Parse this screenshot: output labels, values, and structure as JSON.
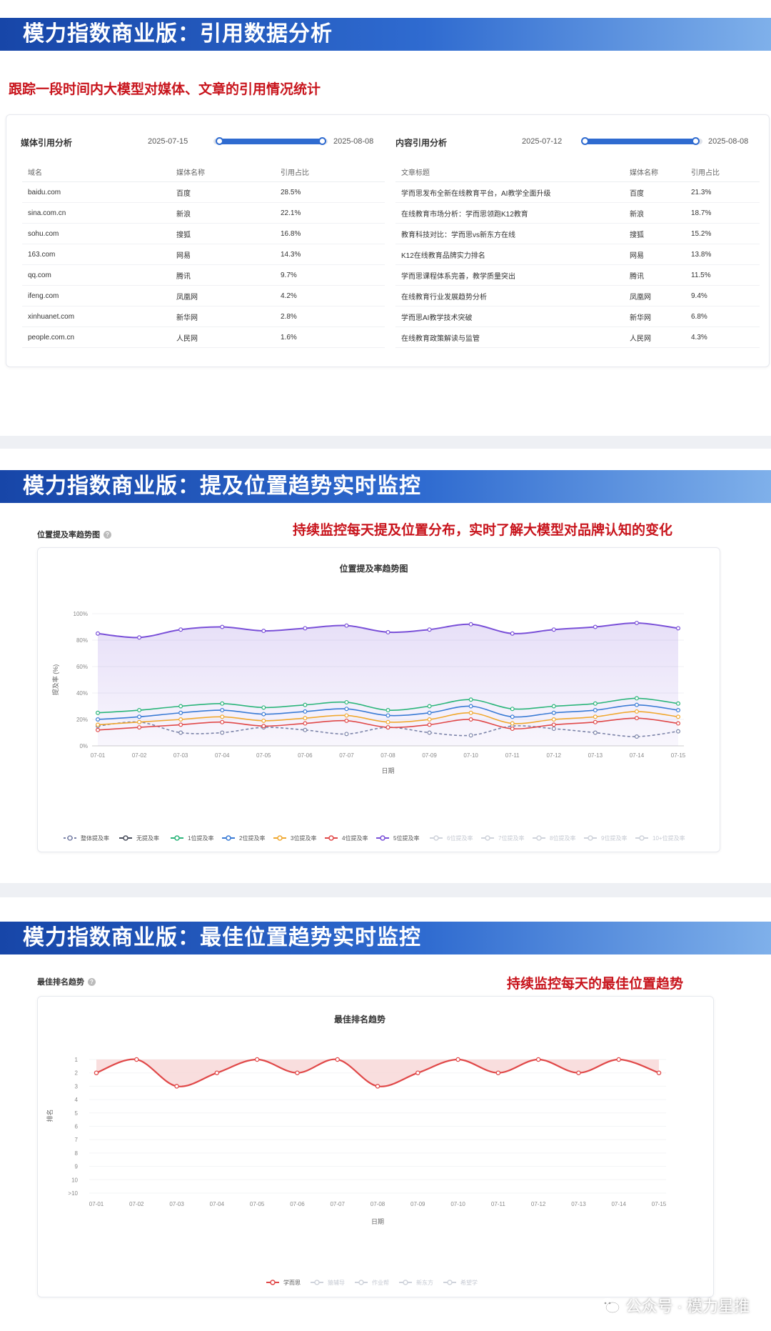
{
  "section1": {
    "banner": "模力指数商业版：引用数据分析",
    "subtitle": "跟踪一段时间内大模型对媒体、文章的引用情况统计",
    "media": {
      "title": "媒体引用分析",
      "date_start": "2025-07-15",
      "date_end": "2025-08-08",
      "headers": [
        "域名",
        "媒体名称",
        "引用占比"
      ],
      "rows": [
        [
          "baidu.com",
          "百度",
          "28.5%"
        ],
        [
          "sina.com.cn",
          "新浪",
          "22.1%"
        ],
        [
          "sohu.com",
          "搜狐",
          "16.8%"
        ],
        [
          "163.com",
          "网易",
          "14.3%"
        ],
        [
          "qq.com",
          "腾讯",
          "9.7%"
        ],
        [
          "ifeng.com",
          "凤凰网",
          "4.2%"
        ],
        [
          "xinhuanet.com",
          "新华网",
          "2.8%"
        ],
        [
          "people.com.cn",
          "人民网",
          "1.6%"
        ]
      ]
    },
    "content": {
      "title": "内容引用分析",
      "date_start": "2025-07-12",
      "date_end": "2025-08-08",
      "headers": [
        "文章标题",
        "媒体名称",
        "引用占比"
      ],
      "rows": [
        [
          "学而思发布全新在线教育平台，AI教学全面升级",
          "百度",
          "21.3%"
        ],
        [
          "在线教育市场分析：学而思领跑K12教育",
          "新浪",
          "18.7%"
        ],
        [
          "教育科技对比：学而思vs新东方在线",
          "搜狐",
          "15.2%"
        ],
        [
          "K12在线教育品牌实力排名",
          "网易",
          "13.8%"
        ],
        [
          "学而思课程体系完善，教学质量突出",
          "腾讯",
          "11.5%"
        ],
        [
          "在线教育行业发展趋势分析",
          "凤凰网",
          "9.4%"
        ],
        [
          "学而思AI教学技术突破",
          "新华网",
          "6.8%"
        ],
        [
          "在线教育政策解读与监管",
          "人民网",
          "4.3%"
        ]
      ]
    }
  },
  "section2": {
    "banner": "模力指数商业版：提及位置趋势实时监控",
    "panel_label": "位置提及率趋势图",
    "subtitle": "持续监控每天提及位置分布，实时了解大模型对品牌认知的变化",
    "chart_data": {
      "type": "area",
      "title": "位置提及率趋势图",
      "xlabel": "日期",
      "ylabel": "提及率 (%)",
      "ylim": [
        0,
        100
      ],
      "y_ticks": [
        "0%",
        "20%",
        "40%",
        "60%",
        "80%",
        "100%"
      ],
      "x": [
        "07-01",
        "07-02",
        "07-03",
        "07-04",
        "07-05",
        "07-06",
        "07-07",
        "07-08",
        "07-09",
        "07-10",
        "07-11",
        "07-12",
        "07-13",
        "07-14",
        "07-15"
      ],
      "series": [
        {
          "name": "整体提及率",
          "color": "#7b83a8",
          "dashed": true,
          "values": [
            15,
            18,
            10,
            10,
            14,
            12,
            9,
            14,
            10,
            8,
            15,
            13,
            10,
            7,
            11
          ]
        },
        {
          "name": "无提及率",
          "color": "#4a4f5c",
          "values": [
            null,
            null,
            null,
            null,
            null,
            null,
            null,
            null,
            null,
            null,
            null,
            null,
            null,
            null,
            null
          ]
        },
        {
          "name": "1位提及率",
          "color": "#2bb57a",
          "values": [
            25,
            27,
            30,
            32,
            29,
            31,
            33,
            27,
            30,
            35,
            28,
            30,
            32,
            36,
            32
          ]
        },
        {
          "name": "2位提及率",
          "color": "#3a7bd5",
          "values": [
            20,
            22,
            25,
            27,
            24,
            26,
            28,
            23,
            25,
            30,
            22,
            25,
            27,
            31,
            27
          ]
        },
        {
          "name": "3位提及率",
          "color": "#f0a830",
          "values": [
            16,
            18,
            20,
            22,
            19,
            21,
            23,
            18,
            20,
            25,
            17,
            20,
            22,
            26,
            22
          ]
        },
        {
          "name": "4位提及率",
          "color": "#e04848",
          "values": [
            12,
            14,
            16,
            18,
            15,
            17,
            19,
            14,
            16,
            20,
            13,
            16,
            18,
            21,
            17
          ]
        },
        {
          "name": "5位提及率",
          "color": "#7a50d8",
          "values": [
            85,
            82,
            88,
            90,
            87,
            89,
            91,
            86,
            88,
            92,
            85,
            88,
            90,
            93,
            89
          ]
        },
        {
          "name": "6位提及率",
          "color": "#cfd3db",
          "values": []
        },
        {
          "name": "7位提及率",
          "color": "#cfd3db",
          "values": []
        },
        {
          "name": "8位提及率",
          "color": "#cfd3db",
          "values": []
        },
        {
          "name": "9位提及率",
          "color": "#cfd3db",
          "values": []
        },
        {
          "name": "10+位提及率",
          "color": "#cfd3db",
          "values": []
        }
      ]
    }
  },
  "section3": {
    "banner": "模力指数商业版：最佳位置趋势实时监控",
    "panel_label": "最佳排名趋势",
    "subtitle": "持续监控每天的最佳位置趋势",
    "chart_data": {
      "type": "line",
      "title": "最佳排名趋势",
      "xlabel": "日期",
      "ylabel": "排名",
      "y_ticks": [
        "1",
        "2",
        "3",
        "4",
        "5",
        "6",
        "7",
        "8",
        "9",
        "10",
        ">10"
      ],
      "x": [
        "07-01",
        "07-02",
        "07-03",
        "07-04",
        "07-05",
        "07-06",
        "07-07",
        "07-08",
        "07-09",
        "07-10",
        "07-11",
        "07-12",
        "07-13",
        "07-14",
        "07-15"
      ],
      "series": [
        {
          "name": "学而思",
          "color": "#e04848",
          "values": [
            2,
            1,
            3,
            2,
            1,
            2,
            1,
            3,
            2,
            1,
            2,
            1,
            2,
            1,
            2
          ]
        },
        {
          "name": "猿辅导",
          "color": "#cfd3db",
          "values": []
        },
        {
          "name": "作业帮",
          "color": "#cfd3db",
          "values": []
        },
        {
          "name": "新东方",
          "color": "#cfd3db",
          "values": []
        },
        {
          "name": "希望学",
          "color": "#cfd3db",
          "values": []
        }
      ]
    }
  },
  "watermark": "公众号 · 模力星推"
}
